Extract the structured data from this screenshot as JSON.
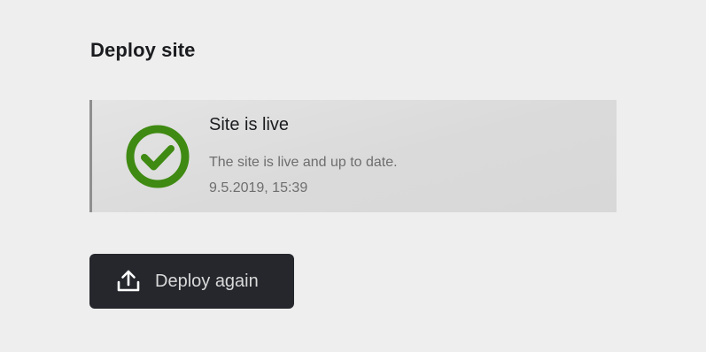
{
  "page": {
    "title": "Deploy site"
  },
  "status": {
    "state": "live",
    "icon": "check-circle-icon",
    "title": "Site is live",
    "message": "The site is live and up to date.",
    "timestamp": "9.5.2019, 15:39",
    "colors": {
      "success": "#3f8a12",
      "card_border": "#8f8f8f"
    }
  },
  "actions": {
    "deploy_label": "Deploy again",
    "deploy_icon": "upload-icon",
    "button_color": "#25272d"
  }
}
